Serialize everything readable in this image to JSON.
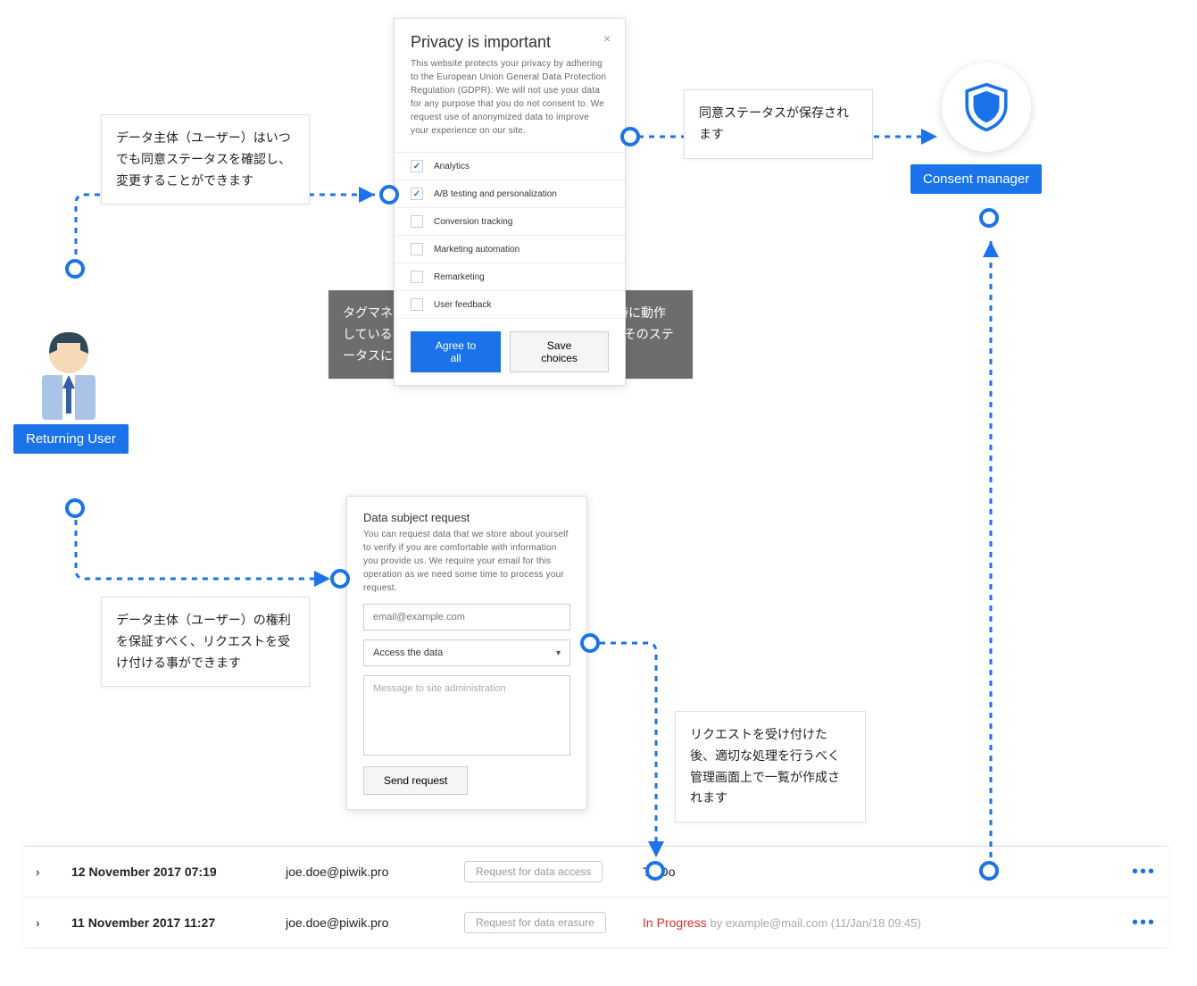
{
  "user_label": "Returning User",
  "consent_label": "Consent manager",
  "callouts": {
    "check_change": "データ主体（ユーザー）はいつでも同意ステータスを確認し、変更することができます",
    "status_saved": "同意ステータスが保存されます",
    "tag_consent_sync": "タグマネージャーとコンセントマネージャーは同時に動作しているため、変更は即時保存され、PiwikPROはそのステータスに即したデータ収集をすぐに開始します",
    "rights_request": "データ主体（ユーザー）の権利を保証すべく、リクエストを受け付ける事ができます",
    "after_request": "リクエストを受け付けた後、適切な処理を行うべく管理画面上で一覧が作成されます"
  },
  "privacy_card": {
    "title": "Privacy is important",
    "desc": "This website protects your privacy by adhering to the European Union General Data Protection Regulation (GDPR). We will not use your data for any purpose that you do not consent to. We request use of anonymized data to improve your experience on our site.",
    "options": [
      {
        "label": "Analytics",
        "checked": true
      },
      {
        "label": "A/B testing and personalization",
        "checked": true
      },
      {
        "label": "Conversion tracking",
        "checked": false
      },
      {
        "label": "Marketing automation",
        "checked": false
      },
      {
        "label": "Remarketing",
        "checked": false
      },
      {
        "label": "User feedback",
        "checked": false
      }
    ],
    "agree_btn": "Agree to all",
    "save_btn": "Save choices"
  },
  "dsr_card": {
    "title": "Data subject request",
    "desc": "You can request data that we store about yourself to verify if you are comfortable with information you provide us. We require your email for this operation as we need some time to process your request.",
    "email_placeholder": "email@example.com",
    "select_value": "Access the data",
    "message_placeholder": "Message to site administration",
    "send_btn": "Send request"
  },
  "requests": [
    {
      "date": "12 November 2017 07:19",
      "email": "joe.doe@piwik.pro",
      "type": "Request for data access",
      "status": "To Do",
      "status_class": ""
    },
    {
      "date": "11 November 2017 11:27",
      "email": "joe.doe@piwik.pro",
      "type": "Request for data erasure",
      "status": "In Progress",
      "status_class": "progress",
      "by": "by example@mail.com (11/Jan/18 09:45)"
    }
  ]
}
